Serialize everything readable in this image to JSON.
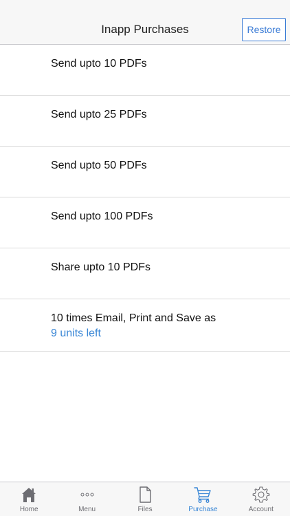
{
  "header": {
    "title": "Inapp Purchases",
    "restore_label": "Restore"
  },
  "items": [
    {
      "title": "Send upto 10 PDFs"
    },
    {
      "title": "Send upto 25 PDFs"
    },
    {
      "title": "Send upto 50 PDFs"
    },
    {
      "title": "Send upto 100 PDFs"
    },
    {
      "title": "Share upto 10 PDFs"
    },
    {
      "title": "10 times Email, Print and Save as",
      "subtitle": "9 units left"
    }
  ],
  "tabs": [
    {
      "label": "Home",
      "icon": "home-icon"
    },
    {
      "label": "Menu",
      "icon": "more-dots-icon"
    },
    {
      "label": "Files",
      "icon": "file-icon"
    },
    {
      "label": "Purchase",
      "icon": "cart-icon",
      "active": true
    },
    {
      "label": "Account",
      "icon": "gear-icon"
    }
  ],
  "colors": {
    "accent": "#3a87d6",
    "tab_inactive": "#6d6d72",
    "bar_background": "#f7f7f7"
  }
}
